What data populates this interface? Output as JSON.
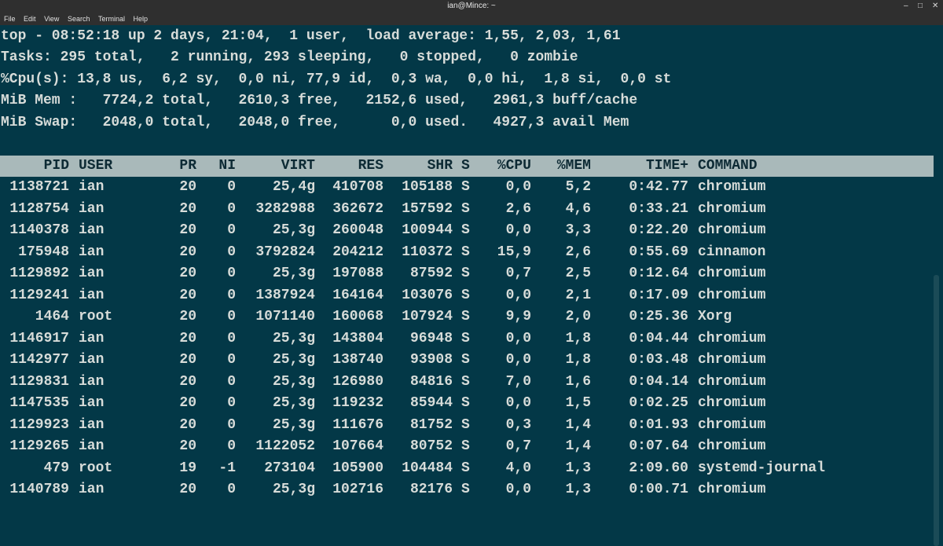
{
  "window": {
    "title": "ian@Mince: ~",
    "controls": {
      "minimize": "–",
      "maximize": "□",
      "close": "✕"
    }
  },
  "menu": [
    "File",
    "Edit",
    "View",
    "Search",
    "Terminal",
    "Help"
  ],
  "summary": [
    "top - 08:52:18 up 2 days, 21:04,  1 user,  load average: 1,55, 2,03, 1,61",
    "Tasks: 295 total,   2 running, 293 sleeping,   0 stopped,   0 zombie",
    "%Cpu(s): 13,8 us,  6,2 sy,  0,0 ni, 77,9 id,  0,3 wa,  0,0 hi,  1,8 si,  0,0 st",
    "MiB Mem :   7724,2 total,   2610,3 free,   2152,6 used,   2961,3 buff/cache",
    "MiB Swap:   2048,0 total,   2048,0 free,      0,0 used.   4927,3 avail Mem"
  ],
  "table": {
    "headers": {
      "pid": "PID",
      "user": "USER",
      "pr": "PR",
      "ni": "NI",
      "virt": "VIRT",
      "res": "RES",
      "shr": "SHR",
      "s": "S",
      "cpu": "%CPU",
      "mem": "%MEM",
      "time": "TIME+",
      "cmd": "COMMAND"
    },
    "rows": [
      {
        "pid": "1138721",
        "user": "ian",
        "pr": "20",
        "ni": "0",
        "virt": "25,4g",
        "res": "410708",
        "shr": "105188",
        "s": "S",
        "cpu": "0,0",
        "mem": "5,2",
        "time": "0:42.77",
        "cmd": "chromium"
      },
      {
        "pid": "1128754",
        "user": "ian",
        "pr": "20",
        "ni": "0",
        "virt": "3282988",
        "res": "362672",
        "shr": "157592",
        "s": "S",
        "cpu": "2,6",
        "mem": "4,6",
        "time": "0:33.21",
        "cmd": "chromium"
      },
      {
        "pid": "1140378",
        "user": "ian",
        "pr": "20",
        "ni": "0",
        "virt": "25,3g",
        "res": "260048",
        "shr": "100944",
        "s": "S",
        "cpu": "0,0",
        "mem": "3,3",
        "time": "0:22.20",
        "cmd": "chromium"
      },
      {
        "pid": "175948",
        "user": "ian",
        "pr": "20",
        "ni": "0",
        "virt": "3792824",
        "res": "204212",
        "shr": "110372",
        "s": "S",
        "cpu": "15,9",
        "mem": "2,6",
        "time": "0:55.69",
        "cmd": "cinnamon"
      },
      {
        "pid": "1129892",
        "user": "ian",
        "pr": "20",
        "ni": "0",
        "virt": "25,3g",
        "res": "197088",
        "shr": "87592",
        "s": "S",
        "cpu": "0,7",
        "mem": "2,5",
        "time": "0:12.64",
        "cmd": "chromium"
      },
      {
        "pid": "1129241",
        "user": "ian",
        "pr": "20",
        "ni": "0",
        "virt": "1387924",
        "res": "164164",
        "shr": "103076",
        "s": "S",
        "cpu": "0,0",
        "mem": "2,1",
        "time": "0:17.09",
        "cmd": "chromium"
      },
      {
        "pid": "1464",
        "user": "root",
        "pr": "20",
        "ni": "0",
        "virt": "1071140",
        "res": "160068",
        "shr": "107924",
        "s": "S",
        "cpu": "9,9",
        "mem": "2,0",
        "time": "0:25.36",
        "cmd": "Xorg"
      },
      {
        "pid": "1146917",
        "user": "ian",
        "pr": "20",
        "ni": "0",
        "virt": "25,3g",
        "res": "143804",
        "shr": "96948",
        "s": "S",
        "cpu": "0,0",
        "mem": "1,8",
        "time": "0:04.44",
        "cmd": "chromium"
      },
      {
        "pid": "1142977",
        "user": "ian",
        "pr": "20",
        "ni": "0",
        "virt": "25,3g",
        "res": "138740",
        "shr": "93908",
        "s": "S",
        "cpu": "0,0",
        "mem": "1,8",
        "time": "0:03.48",
        "cmd": "chromium"
      },
      {
        "pid": "1129831",
        "user": "ian",
        "pr": "20",
        "ni": "0",
        "virt": "25,3g",
        "res": "126980",
        "shr": "84816",
        "s": "S",
        "cpu": "7,0",
        "mem": "1,6",
        "time": "0:04.14",
        "cmd": "chromium"
      },
      {
        "pid": "1147535",
        "user": "ian",
        "pr": "20",
        "ni": "0",
        "virt": "25,3g",
        "res": "119232",
        "shr": "85944",
        "s": "S",
        "cpu": "0,0",
        "mem": "1,5",
        "time": "0:02.25",
        "cmd": "chromium"
      },
      {
        "pid": "1129923",
        "user": "ian",
        "pr": "20",
        "ni": "0",
        "virt": "25,3g",
        "res": "111676",
        "shr": "81752",
        "s": "S",
        "cpu": "0,3",
        "mem": "1,4",
        "time": "0:01.93",
        "cmd": "chromium"
      },
      {
        "pid": "1129265",
        "user": "ian",
        "pr": "20",
        "ni": "0",
        "virt": "1122052",
        "res": "107664",
        "shr": "80752",
        "s": "S",
        "cpu": "0,7",
        "mem": "1,4",
        "time": "0:07.64",
        "cmd": "chromium"
      },
      {
        "pid": "479",
        "user": "root",
        "pr": "19",
        "ni": "-1",
        "virt": "273104",
        "res": "105900",
        "shr": "104484",
        "s": "S",
        "cpu": "4,0",
        "mem": "1,3",
        "time": "2:09.60",
        "cmd": "systemd-journal"
      },
      {
        "pid": "1140789",
        "user": "ian",
        "pr": "20",
        "ni": "0",
        "virt": "25,3g",
        "res": "102716",
        "shr": "82176",
        "s": "S",
        "cpu": "0,0",
        "mem": "1,3",
        "time": "0:00.71",
        "cmd": "chromium"
      }
    ]
  },
  "colors": {
    "background": "#033847",
    "text": "#d7dcd9",
    "header_bar": "#a9b9ba",
    "titlebar": "#2f2f2f"
  }
}
